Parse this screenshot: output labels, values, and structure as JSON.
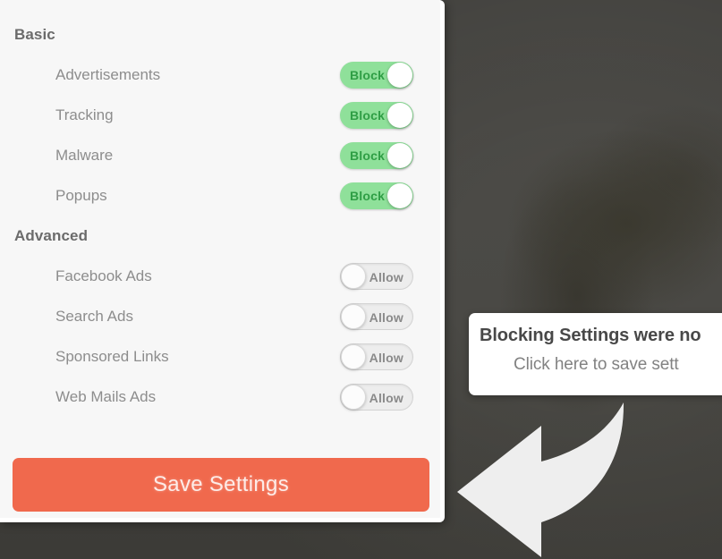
{
  "panel": {
    "sections": [
      {
        "header": "Basic",
        "rows": [
          {
            "label": "Advertisements",
            "toggle_label": "Block",
            "state": "on"
          },
          {
            "label": "Tracking",
            "toggle_label": "Block",
            "state": "on"
          },
          {
            "label": "Malware",
            "toggle_label": "Block",
            "state": "on"
          },
          {
            "label": "Popups",
            "toggle_label": "Block",
            "state": "on"
          }
        ]
      },
      {
        "header": "Advanced",
        "rows": [
          {
            "label": "Facebook Ads",
            "toggle_label": "Allow",
            "state": "off"
          },
          {
            "label": "Search Ads",
            "toggle_label": "Allow",
            "state": "off"
          },
          {
            "label": "Sponsored Links",
            "toggle_label": "Allow",
            "state": "off"
          },
          {
            "label": "Web Mails Ads",
            "toggle_label": "Allow",
            "state": "off"
          }
        ]
      }
    ],
    "save_button_label": "Save Settings"
  },
  "tooltip": {
    "title": "Blocking Settings were no",
    "subtitle": "Click here to save sett"
  },
  "colors": {
    "toggle_on_track": "#8fe09a",
    "toggle_on_text": "#2f9e45",
    "toggle_off_track": "#ededed",
    "toggle_off_text": "#8a8a8a",
    "save_button": "#f0694d",
    "panel_background": "#f7f7f7",
    "backdrop": "#4a4945",
    "arrow": "#eeeeee"
  }
}
